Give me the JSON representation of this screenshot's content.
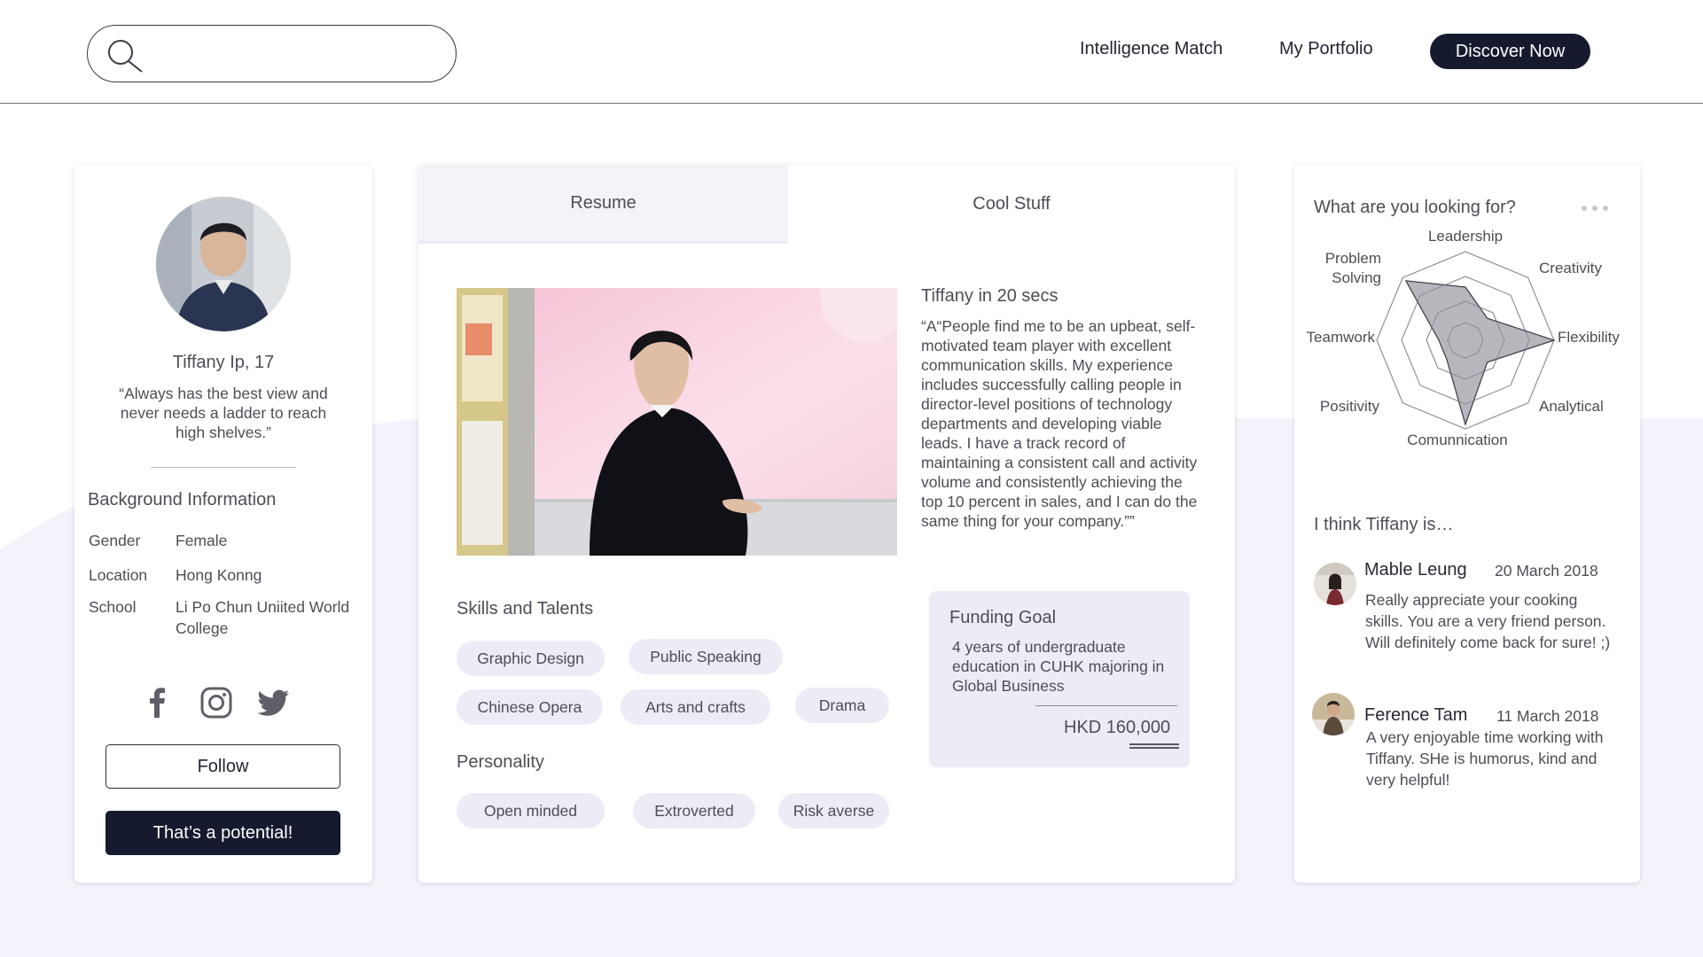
{
  "header": {
    "search_placeholder": "",
    "nav": [
      "Intelligence Match",
      "My Portfolio"
    ],
    "cta": "Discover Now"
  },
  "profile": {
    "name": "Tiffany Ip, 17",
    "quote": "“Always has the best view and never needs a ladder to reach high shelves.”",
    "background_title": "Background Information",
    "fields": [
      {
        "label": "Gender",
        "value": "Female"
      },
      {
        "label": "Location",
        "value": "Hong Konng"
      },
      {
        "label": "School",
        "value": "Li Po Chun Uniited World College"
      }
    ],
    "social": [
      "facebook-icon",
      "instagram-icon",
      "twitter-icon"
    ],
    "follow_label": "Follow",
    "potential_label": "That’s a potential!"
  },
  "main": {
    "tabs": [
      "Resume",
      "Cool Stuff"
    ],
    "active_tab": "Resume",
    "intro_title": "Tiffany in 20 secs",
    "intro_text": "“A“People find me to be an upbeat, self-motivated team player with excellent communication skills. My experience includes successfully calling people in director-level positions of technology departments and developing viable leads. I have a track record of maintaining a consistent call and activity volume and consistently achieving the top 10 percent in sales, and I can do the same thing for your company.””",
    "skills_title": "Skills and Talents",
    "skills": [
      "Graphic Design",
      "Public Speaking",
      "Chinese Opera",
      "Arts and crafts",
      "Drama"
    ],
    "personality_title": "Personality",
    "personality": [
      "Open minded",
      "Extroverted",
      "Risk averse"
    ],
    "funding": {
      "title": "Funding Goal",
      "description": "4 years of undergraduate education in CUHK majoring in Global Business",
      "amount": "HKD 160,000"
    }
  },
  "sidebar": {
    "looking_title": "What are you looking for?",
    "radar_axes": [
      "Leadership",
      "Creativity",
      "Flexibility",
      "Analytical",
      "Comunnication",
      "Positivity",
      "Teamwork",
      "Problem Solving"
    ],
    "radar_values": [
      0.6,
      0.35,
      1.0,
      0.35,
      0.95,
      0.3,
      0.3,
      0.95
    ],
    "think_title": "I think Tiffany is…",
    "reviews": [
      {
        "name": "Mable Leung",
        "date": "20 March 2018",
        "text": "Really appreciate your cooking skills. You are a very friend person. Will definitely come back for sure! ;)"
      },
      {
        "name": "Ference Tam",
        "date": "11 March 2018",
        "text": "A very enjoyable time working with Tiffany. SHe is humorus, kind and very helpful!"
      }
    ]
  },
  "colors": {
    "accent_dark": "#151a2e",
    "chip_bg": "#ececf6",
    "page_wave": "#f3f3fb",
    "radar_fill": "#a9a9b0"
  }
}
